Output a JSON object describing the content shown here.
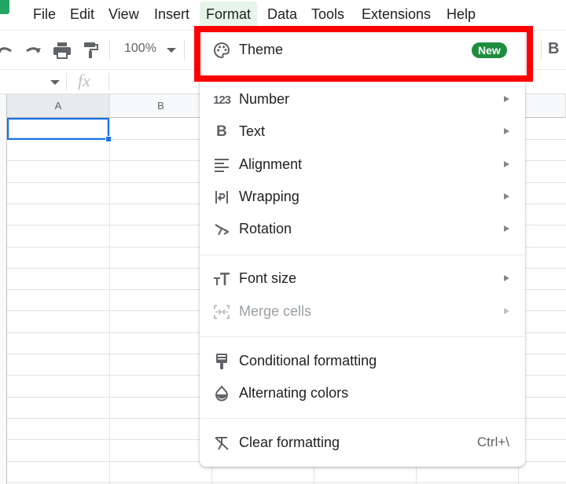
{
  "menubar": {
    "items": [
      {
        "label": "File"
      },
      {
        "label": "Edit"
      },
      {
        "label": "View"
      },
      {
        "label": "Insert"
      },
      {
        "label": "Format",
        "active": true
      },
      {
        "label": "Data"
      },
      {
        "label": "Tools"
      },
      {
        "label": "Extensions"
      },
      {
        "label": "Help"
      }
    ]
  },
  "toolbar": {
    "undo_icon": "undo-icon",
    "redo_icon": "redo-icon",
    "print_icon": "print-icon",
    "paint_format_icon": "paint-format-icon",
    "zoom": "100%",
    "bold_label": "B"
  },
  "formula_bar": {
    "fx_label": "fx",
    "value": ""
  },
  "grid": {
    "columns": [
      "A",
      "B"
    ],
    "selected_cell": "A1"
  },
  "format_menu": {
    "items": [
      {
        "label": "Theme",
        "icon": "palette-icon",
        "badge": "New"
      },
      {
        "label": "Number",
        "icon": "number-123-icon",
        "submenu": true
      },
      {
        "label": "Text",
        "icon": "bold-b-icon",
        "submenu": true
      },
      {
        "label": "Alignment",
        "icon": "align-left-icon",
        "submenu": true
      },
      {
        "label": "Wrapping",
        "icon": "wrap-icon",
        "submenu": true
      },
      {
        "label": "Rotation",
        "icon": "rotation-icon",
        "submenu": true
      },
      {
        "label": "Font size",
        "icon": "font-size-icon",
        "submenu": true
      },
      {
        "label": "Merge cells",
        "icon": "merge-cells-icon",
        "submenu": true,
        "disabled": true
      },
      {
        "label": "Conditional formatting",
        "icon": "conditional-format-icon"
      },
      {
        "label": "Alternating colors",
        "icon": "alternating-colors-icon"
      },
      {
        "label": "Clear formatting",
        "icon": "clear-format-icon",
        "shortcut": "Ctrl+\\"
      }
    ]
  },
  "colors": {
    "highlight": "#ff0000",
    "badge": "#1e8e3e",
    "selection": "#1a73e8",
    "active_menu": "#e6f4ea"
  }
}
